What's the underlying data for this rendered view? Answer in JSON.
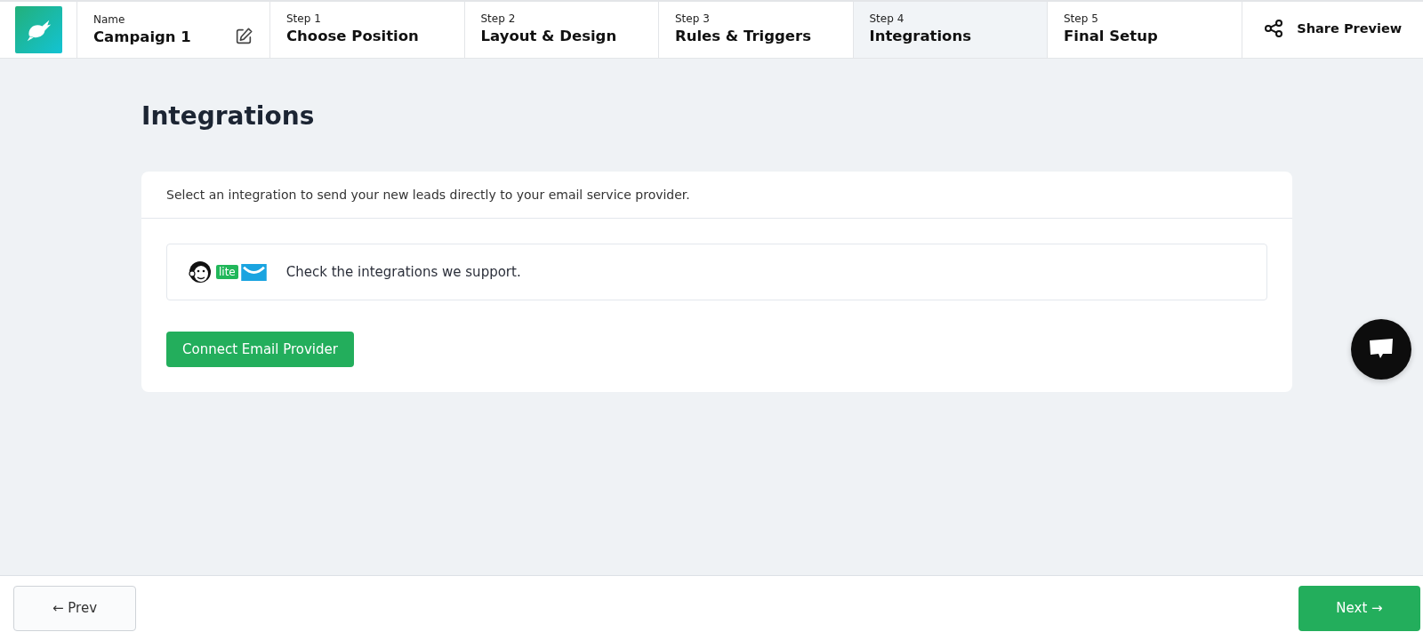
{
  "header": {
    "name_label": "Name",
    "name_value": "Campaign 1",
    "steps": [
      {
        "label": "Step 1",
        "title": "Choose Position",
        "selected": false
      },
      {
        "label": "Step 2",
        "title": "Layout & Design",
        "selected": false
      },
      {
        "label": "Step 3",
        "title": "Rules & Triggers",
        "selected": false
      },
      {
        "label": "Step 4",
        "title": "Integrations",
        "selected": true
      },
      {
        "label": "Step 5",
        "title": "Final Setup",
        "selected": false
      }
    ],
    "share_button": "Share Preview"
  },
  "page_title": "Integrations",
  "card": {
    "description": "Select an integration to send your new leads directly to your email service provider.",
    "integrations_badge": "lite",
    "integrations_text": "Check the integrations we support.",
    "connect_button": "Connect Email Provider"
  },
  "footer": {
    "prev_button": "← Prev",
    "next_button": "Next →"
  }
}
